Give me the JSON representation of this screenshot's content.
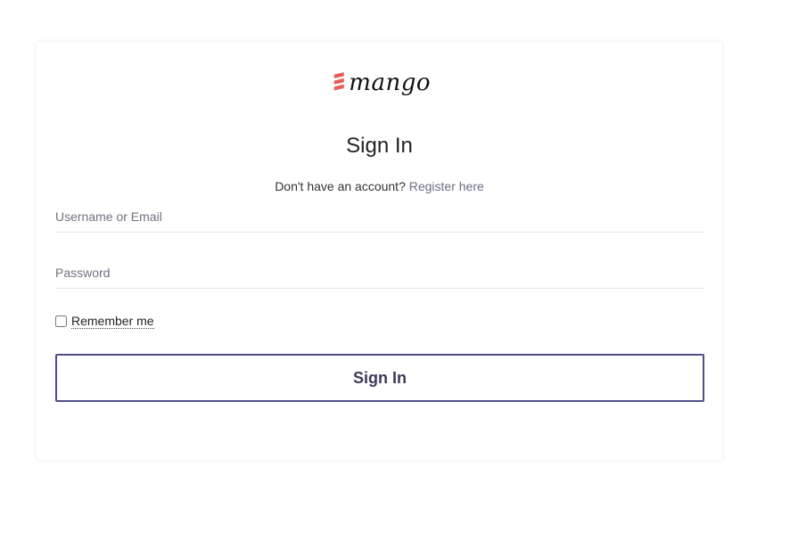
{
  "brand": {
    "name": "mango",
    "accent_color": "#e85b58"
  },
  "form": {
    "title": "Sign In",
    "no_account_text": "Don't have an account?",
    "register_link": "Register here",
    "username_placeholder": "Username or Email",
    "password_placeholder": "Password",
    "remember_label": "Remember me",
    "remember_checked": false,
    "submit_label": "Sign In",
    "button_border_color": "#4e4d86"
  }
}
